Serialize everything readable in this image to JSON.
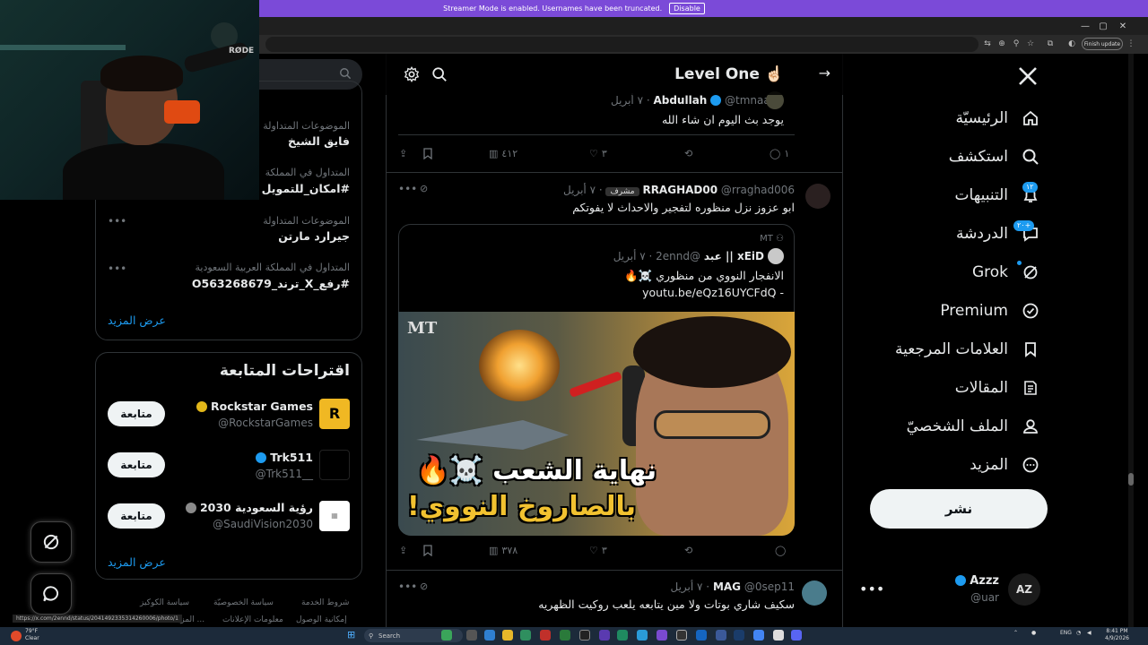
{
  "banner": {
    "text": "Streamer Mode is enabled. Usernames have been truncated.",
    "disable": "Disable"
  },
  "browser": {
    "finish_update": "Finish update"
  },
  "webcam": {
    "mic_brand": "RØDE"
  },
  "nav": {
    "items": [
      {
        "label": "الرئيسيّة",
        "icon": "home-icon"
      },
      {
        "label": "استكشف",
        "icon": "search-icon"
      },
      {
        "label": "التنبيهات",
        "icon": "bell-icon",
        "badge": "١٢"
      },
      {
        "label": "الدردشة",
        "icon": "chat-icon",
        "badge": "٢٠+"
      },
      {
        "label": "Grok",
        "icon": "grok-icon"
      },
      {
        "label": "Premium",
        "icon": "premium-icon"
      },
      {
        "label": "العلامات المرجعية",
        "icon": "bookmark-icon"
      },
      {
        "label": "المقالات",
        "icon": "article-icon"
      },
      {
        "label": "الملف الشخصيّ",
        "icon": "profile-icon"
      },
      {
        "label": "المزيد",
        "icon": "more-icon"
      }
    ],
    "post": "نشر",
    "account": {
      "name": "Azzz",
      "handle": "@uar",
      "avatar": "AZ"
    }
  },
  "main": {
    "title": "Level One",
    "title_emoji": "☝🏻",
    "tweet1": {
      "name": "Abdullah",
      "handle": "@tmnaa16",
      "date": "٧ أبريل",
      "text": "يوجد بث اليوم ان شاء الله",
      "views": "٤١٢",
      "likes": "٣",
      "replies": "١"
    },
    "tweet2": {
      "name": "RRAGHAD00",
      "handle": "@rraghad006",
      "badge": "مشرف",
      "date": "٧ أبريل",
      "text": "ابو عزوز نزل منظوره لتفجير والاحداث لا يفوتكم",
      "quote": {
        "community": "MT",
        "name": "xEiD || عبد",
        "handle": "@2ennd",
        "date": "٧ أبريل",
        "text": "الانفجار النووي من منظوري ☠️🔥",
        "link": "youtu.be/eQz16UYCFdQ -"
      },
      "media": {
        "logo": "MT",
        "caption_top": "نهاية الشعب ☠️🔥",
        "caption_bottom": "بالصاروخ النووي!"
      },
      "views": "٣٧٨",
      "likes": "٣"
    },
    "tweet3": {
      "name": "MAG",
      "handle": "@0sep11",
      "date": "٧ أبريل",
      "text": "سكيف شاري بوتات ولا مين يتابعه يلعب روكيت الظهريه"
    }
  },
  "sidebar": {
    "trends": [
      {
        "context": "الموضوعات المتداولة",
        "name": "فايق الشيخ"
      },
      {
        "context": "المتداول في المملكة",
        "name": "#امكان_للتمويل"
      },
      {
        "context": "الموضوعات المتداولة",
        "name": "جيرارد مارتن"
      },
      {
        "context": "المتداول في المملكة العربية السعودية",
        "name": "#رفع_X_ترند_O563268679"
      }
    ],
    "show_more": "عرض المزيد",
    "follows_title": "اقتراحات المتابعة",
    "follows": [
      {
        "name": "Rockstar Games",
        "handle": "@RockstarGames",
        "button": "متابعة",
        "avatar_color": "#f0b823"
      },
      {
        "name": "Trk511",
        "handle": "@Trk511__",
        "button": "متابعة",
        "avatar_color": "#000000"
      },
      {
        "name": "رؤية السعودية 2030",
        "handle": "@SaudiVision2030",
        "button": "متابعة",
        "avatar_color": "#ffffff"
      }
    ],
    "footer": [
      "شروط الخدمة",
      "سياسة الخصوصيّة",
      "سياسة الكوكيز",
      "إمكانية الوصول",
      "معلومات الإعلانات",
      "المزيد ..."
    ]
  },
  "status_url": "https://x.com/2ennd/status/2041492335314260006/photo/1",
  "taskbar": {
    "weather_temp": "79°F",
    "weather_desc": "Clear",
    "search": "Search",
    "lang": "ENG",
    "time": "8:41 PM",
    "date": "4/9/2026"
  },
  "colors": {
    "accent": "#1d9bf0",
    "banner": "#7b4ad8",
    "background": "#000000"
  }
}
